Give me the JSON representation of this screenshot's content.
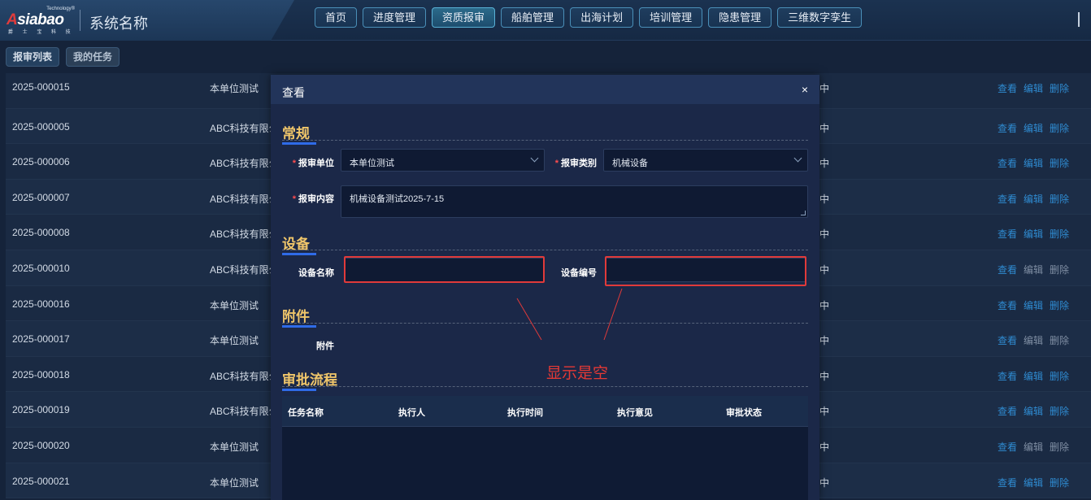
{
  "header": {
    "logo": {
      "tech": "Technology®",
      "word": "Asiabao",
      "sub": "爵 士 宝 科 技"
    },
    "system_name": "系统名称",
    "nav": [
      "首页",
      "进度管理",
      "资质报审",
      "船舶管理",
      "出海计划",
      "培训管理",
      "隐患管理",
      "三维数字孪生"
    ],
    "active_nav_index": 2
  },
  "subtabs": [
    "报审列表",
    "我的任务"
  ],
  "table": {
    "rows": [
      {
        "no": "2025-000015",
        "unit": "本单位测试",
        "status": "中"
      },
      {
        "no": "2025-000005",
        "unit": "ABC科技有限公司",
        "status": "中"
      },
      {
        "no": "2025-000006",
        "unit": "ABC科技有限公司",
        "status": "中"
      },
      {
        "no": "2025-000007",
        "unit": "ABC科技有限公司",
        "status": "中"
      },
      {
        "no": "2025-000008",
        "unit": "ABC科技有限公司",
        "status": "中"
      },
      {
        "no": "2025-000010",
        "unit": "ABC科技有限公司",
        "status": "中"
      },
      {
        "no": "2025-000016",
        "unit": "本单位测试",
        "status": "中"
      },
      {
        "no": "2025-000017",
        "unit": "本单位测试",
        "status": "中"
      },
      {
        "no": "2025-000018",
        "unit": "ABC科技有限公司",
        "status": "中"
      },
      {
        "no": "2025-000019",
        "unit": "ABC科技有限公司",
        "status": "中"
      },
      {
        "no": "2025-000020",
        "unit": "本单位测试",
        "status": "中"
      },
      {
        "no": "2025-000021",
        "unit": "本单位测试",
        "status": "中"
      }
    ],
    "ops": {
      "view": "查看",
      "edit": "编辑",
      "delete": "删除"
    }
  },
  "modal": {
    "title": "查看",
    "close": "×",
    "sections": {
      "general": "常规",
      "equipment": "设备",
      "attachment": "附件",
      "approval": "审批流程"
    },
    "fields": {
      "unit_label": "报审单位",
      "unit_value": "本单位测试",
      "type_label": "报审类别",
      "type_value": "机械设备",
      "content_label": "报审内容",
      "content_value": "机械设备测试2025-7-15",
      "equip_name_label": "设备名称",
      "equip_name_value": "",
      "equip_no_label": "设备编号",
      "equip_no_value": "",
      "attachment_label": "附件"
    },
    "approval_columns": [
      "任务名称",
      "执行人",
      "执行时间",
      "执行意见",
      "审批状态"
    ]
  },
  "annotation": {
    "text": "显示是空",
    "color": "#e53935"
  }
}
